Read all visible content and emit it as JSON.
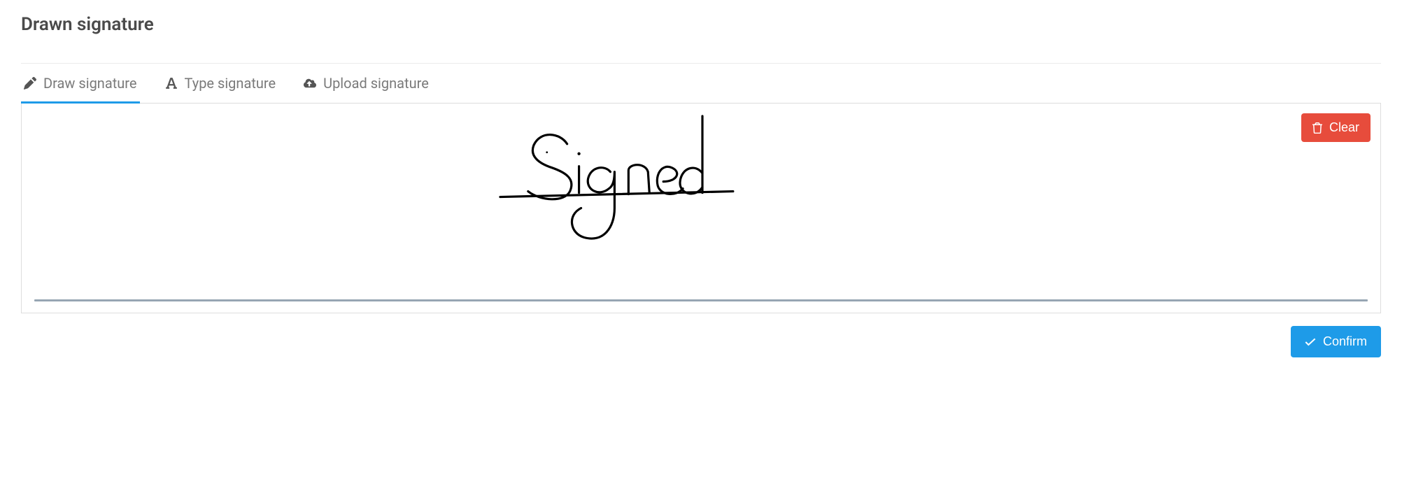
{
  "title": "Drawn signature",
  "tabs": [
    {
      "id": "draw",
      "label": "Draw signature",
      "icon": "pencil-icon",
      "active": true
    },
    {
      "id": "type",
      "label": "Type signature",
      "icon": "font-icon",
      "active": false
    },
    {
      "id": "upload",
      "label": "Upload signature",
      "icon": "cloud-upload-icon",
      "active": false
    }
  ],
  "clear_label": "Clear",
  "confirm_label": "Confirm",
  "signature_present": true,
  "signature_description": "Handwritten word 'Signed' with underline",
  "colors": {
    "accent": "#1e9be8",
    "danger": "#e74c3c",
    "baseline": "#97a6b3"
  }
}
